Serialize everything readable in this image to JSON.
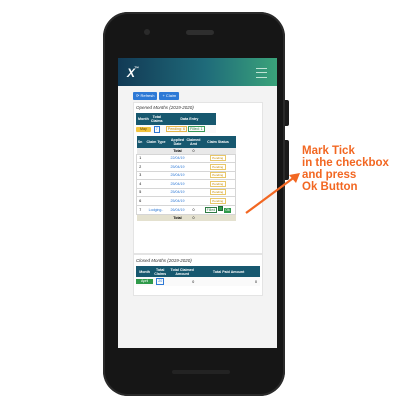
{
  "appbar": {
    "logo": "X",
    "logo_mark": "™"
  },
  "toolbar": {
    "refresh_label": "⟳ Refresh",
    "claim_label": "+ Claim"
  },
  "opened": {
    "title": "Opened Months  (2019-2020)",
    "headers": {
      "month": "Month",
      "total_claims": "Total Claims",
      "data_entry": "Data Entry"
    },
    "row": {
      "month": "May",
      "total": "7",
      "pending": "Pending: 6",
      "filled": "Filled: 1"
    }
  },
  "inner": {
    "headers": {
      "sn": "Sn",
      "type": "Claim Type",
      "applied": "Applied Date",
      "claimed": "Claimed Amt",
      "status": "Claim Status"
    },
    "total_row": {
      "label": "Total",
      "value": "0"
    },
    "rows": [
      {
        "sn": "1",
        "type": "",
        "date": "22/04/19",
        "amt": "",
        "status": "Pending"
      },
      {
        "sn": "2",
        "type": "",
        "date": "25/04/19",
        "amt": "",
        "status": "Pending"
      },
      {
        "sn": "3",
        "type": "",
        "date": "25/04/19",
        "amt": "",
        "status": "Pending"
      },
      {
        "sn": "4",
        "type": "",
        "date": "25/04/19",
        "amt": "",
        "status": "Pending"
      },
      {
        "sn": "5",
        "type": "",
        "date": "25/04/19",
        "amt": "",
        "status": "Pending"
      },
      {
        "sn": "6",
        "type": "",
        "date": "25/04/19",
        "amt": "",
        "status": "Pending"
      }
    ],
    "last_row": {
      "sn": "7",
      "type": "Lodging..",
      "date": "26/04/19",
      "amt": "0",
      "filled": "Filled",
      "ok": "Ok"
    },
    "footer": {
      "label": "Total",
      "value": "0"
    }
  },
  "closed": {
    "title": "Closed Months  (2019-2020)",
    "headers": {
      "month": "Month",
      "total_claims": "Total Claims",
      "claimed": "Total Claimed Amount",
      "paid": "Total Paid Amount"
    },
    "row": {
      "month": "April",
      "claims": "20",
      "claimed": "0",
      "paid": "0"
    }
  },
  "annotation": {
    "line1": "Mark Tick",
    "line2": "in the checkbox",
    "line3": "and press",
    "line4": "Ok Button"
  },
  "colors": {
    "accent_orange": "#f26722",
    "header_teal": "#17586f",
    "button_blue": "#2d79d6",
    "ok_green": "#2f9a4a"
  }
}
